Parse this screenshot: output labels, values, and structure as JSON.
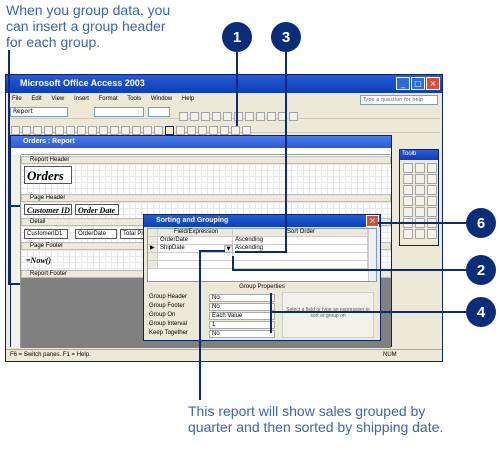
{
  "annotations": {
    "top_note": [
      "When you group data, you",
      "can insert a group header",
      "for each group."
    ],
    "bottom_note": [
      "This report will show sales grouped by",
      "quarter and then sorted by shipping date."
    ],
    "callouts": [
      "1",
      "3",
      "6",
      "2",
      "4"
    ]
  },
  "app": {
    "title": "Microsoft Office Access 2003",
    "menu": [
      "File",
      "Edit",
      "View",
      "Insert",
      "Format",
      "Tools",
      "Window",
      "Help"
    ],
    "help_placeholder": "Type a question for help",
    "object_combo": "Report",
    "status_left": "F6 = Switch panes.  F1 = Help.",
    "status_right": "NUM"
  },
  "report_window": {
    "title": "Orders : Report",
    "sections": {
      "report_header": "Report Header",
      "page_header": "Page Header",
      "detail": "Detail",
      "page_footer": "Page Footer",
      "report_footer": "Report Footer"
    },
    "report_title": "Orders",
    "page_header_labels": [
      "Customer ID",
      "Order Date"
    ],
    "detail_fields": [
      "CustomerID1",
      "OrderDate",
      "Total Pric"
    ],
    "footer_expr": "=Now()"
  },
  "sorting_grouping": {
    "title": "Sorting and Grouping",
    "headers": [
      "Field/Expression",
      "Sort Order"
    ],
    "rows": [
      {
        "field": "OrderDate",
        "order": "Ascending"
      },
      {
        "field": "ShipDate",
        "order": "Ascending"
      }
    ],
    "group_properties_title": "Group Properties",
    "properties": [
      {
        "label": "Group Header",
        "value": "No"
      },
      {
        "label": "Group Footer",
        "value": "No"
      },
      {
        "label": "Group On",
        "value": "Each Value"
      },
      {
        "label": "Group Interval",
        "value": "1"
      },
      {
        "label": "Keep Together",
        "value": "No"
      }
    ],
    "hint": "Select a field or type an expression to sort or group on"
  },
  "toolbox": {
    "title": "Toolb"
  }
}
